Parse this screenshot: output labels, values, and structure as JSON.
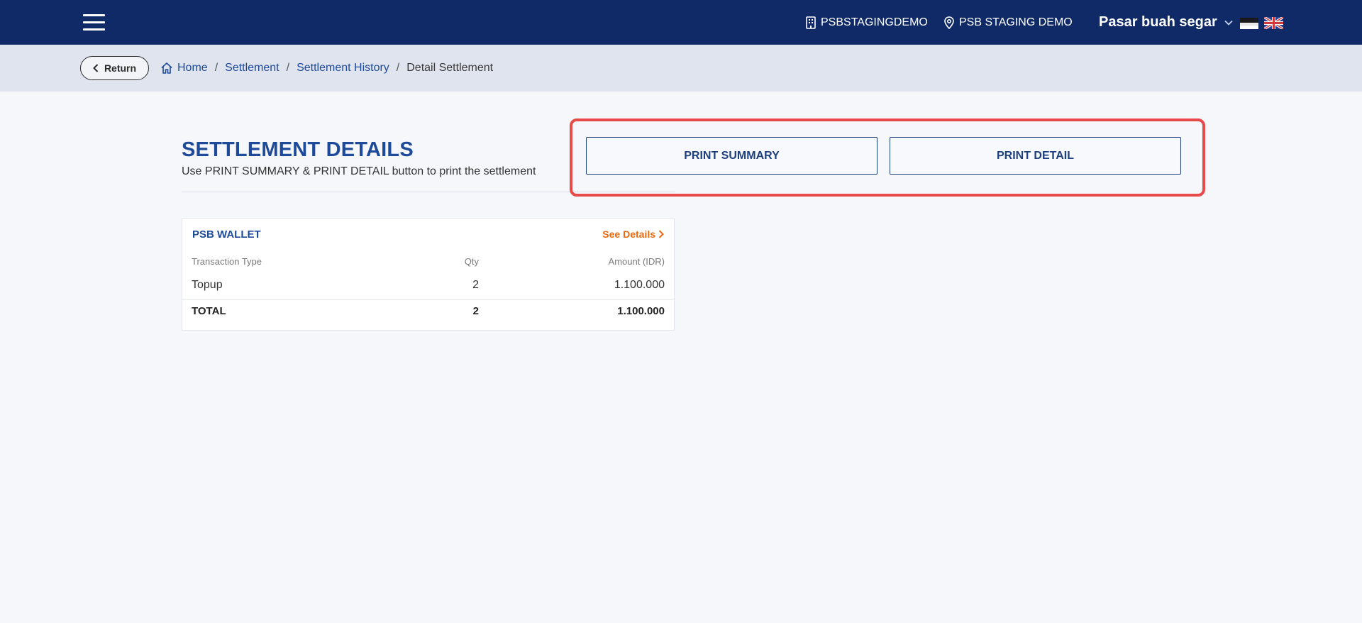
{
  "topbar": {
    "merchant_code": "PSBSTAGINGDEMO",
    "location_name": "PSB STAGING DEMO",
    "store_name": "Pasar buah segar",
    "icons": {
      "menu": "hamburger-menu-icon",
      "merchant": "building-icon",
      "location": "map-pin-icon",
      "dropdown": "chevron-down-icon",
      "flag_id": "indonesia-flag-icon",
      "flag_en": "uk-flag-icon"
    },
    "colors": {
      "background": "#0f2a66"
    }
  },
  "breadcrumb_bar": {
    "return_label": "Return",
    "items": [
      "Home",
      "Settlement",
      "Settlement History"
    ],
    "current": "Detail Settlement",
    "separator": "/"
  },
  "page": {
    "title": "SETTLEMENT DETAILS",
    "subtitle": "Use PRINT SUMMARY & PRINT DETAIL button to print the settlement",
    "print_summary_label": "PRINT SUMMARY",
    "print_detail_label": "PRINT DETAIL",
    "highlight_color": "#e84a4a"
  },
  "wallet_card": {
    "title": "PSB WALLET",
    "see_details_label": "See Details",
    "columns": [
      "Transaction Type",
      "Qty",
      "Amount (IDR)"
    ],
    "rows": [
      {
        "type": "Topup",
        "qty": "2",
        "amount": "1.100.000"
      }
    ],
    "total": {
      "label": "TOTAL",
      "qty": "2",
      "amount": "1.100.000"
    },
    "accent_color": "#ea6a12"
  }
}
